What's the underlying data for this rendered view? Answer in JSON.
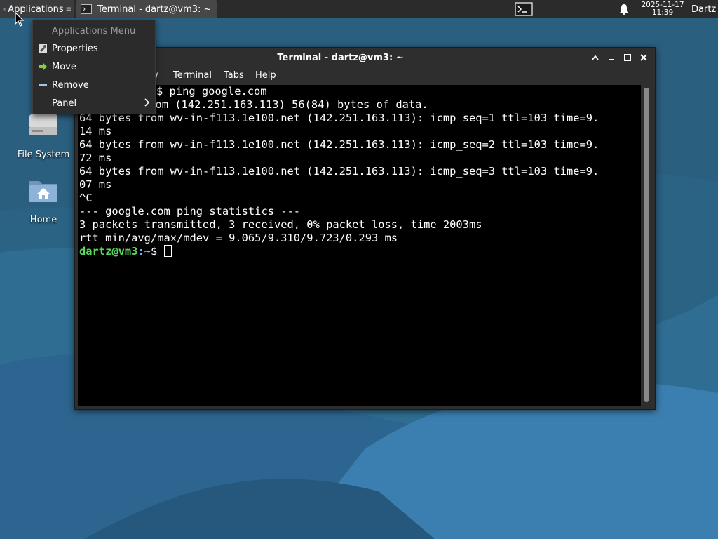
{
  "top_panel": {
    "apps_label": "Applications",
    "task_label": "Terminal - dartz@vm3: ~",
    "clock_date": "2025-11-17",
    "clock_time": "11:39",
    "user_label": "Dartz"
  },
  "apps_menu": {
    "title": "Applications Menu",
    "items": [
      {
        "label": "Properties",
        "icon": "properties-icon"
      },
      {
        "label": "Move",
        "icon": "move-arrow-icon"
      },
      {
        "label": "Remove",
        "icon": "remove-icon"
      },
      {
        "label": "Panel",
        "icon": "",
        "submenu": true
      }
    ]
  },
  "desktop_icons": [
    {
      "label": "File System",
      "icon": "drive-icon"
    },
    {
      "label": "Home",
      "icon": "home-folder-icon"
    }
  ],
  "terminal": {
    "title": "Terminal - dartz@vm3: ~",
    "menu": [
      "w",
      "Terminal",
      "Tabs",
      "Help"
    ],
    "lines": [
      "$ ping google.com",
      ".com (142.251.163.113) 56(84) bytes of data.",
      "64 bytes from wv-in-f113.1e100.net (142.251.163.113): icmp_seq=1 ttl=103 time=9.",
      "14 ms",
      "64 bytes from wv-in-f113.1e100.net (142.251.163.113): icmp_seq=2 ttl=103 time=9.",
      "72 ms",
      "64 bytes from wv-in-f113.1e100.net (142.251.163.113): icmp_seq=3 ttl=103 time=9.",
      "07 ms",
      "^C",
      "--- google.com ping statistics ---",
      "3 packets transmitted, 3 received, 0% packet loss, time 2003ms",
      "rtt min/avg/max/mdev = 9.065/9.310/9.723/0.293 ms"
    ],
    "prompt_user": "dartz@vm3",
    "prompt_path": ":~",
    "prompt_symbol": "$ "
  },
  "colors": {
    "prompt_user": "#59d85b",
    "prompt_path": "#7faaff",
    "panel_bg": "#2b2b2b",
    "terminal_bg": "#000000"
  }
}
